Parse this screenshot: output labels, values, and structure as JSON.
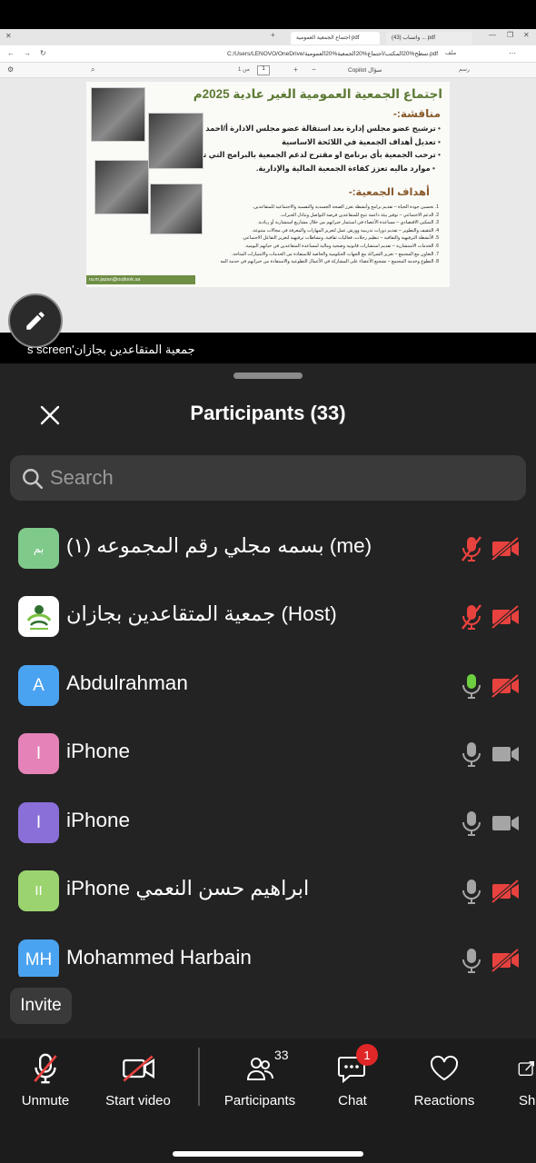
{
  "shared_screen": {
    "caption": "s screen'جمعية المتقاعدين بجازان",
    "browser": {
      "tabs": [
        "اجتماع الجمعية العمومية pdf",
        "(43) واتساب ... pdf"
      ],
      "url": "C:/Users/LENOVO/OneDrive/سطح%20المكتب/اجتماع%20الجمعية%20العمومية.pdf",
      "url_prefix": "ملف",
      "pdf_toolbar": {
        "copilot": "Copilot  سؤال",
        "page_current": "1",
        "page_total": "من 1",
        "draw_label": "رسم"
      }
    },
    "slide": {
      "title": "اجتماع الجمعية العمومية الغير عادية 2025م",
      "discussion_heading": "مناقشة:-",
      "bullets": [
        "ترشيح عضو مجلس إدارة بعد استقالة عضو مجلس الادارة أ/احمد كناني",
        "تعديل أهداف الجمعية في اللائحة الاساسية",
        "ترحب الجمعية بأي برنامج او مقترح لدعم الجمعية بالبرامج التي تقدم",
        "موارد ماليه تعزز كفاءة الجمعية المالية والإدارية."
      ],
      "goals_heading": "أهداف الجمعية:-",
      "goals": [
        "1. تحسين جودة الحياة – تقديم برامج وأنشطة تعزز الصحة الجسدية والنفسية والاجتماعية للمتقاعدين.",
        "2. الدعم الاجتماعي – توفير بيئة داعمة تتيح للمتقاعدين فرصة التواصل وتبادل الخبرات.",
        "3. التمكين الاقتصادي – مساعدة الأعضاء في استثمار خبراتهم من خلال مشاريع استشارية أو ريادية.",
        "4. التثقيف والتطوير – تقديم دورات تدريبية وورش عمل لتعزيز المهارات والمعرفة في مجالات متنوعة.",
        "5. الأنشطة الترفيهية والثقافية – تنظيم رحلات، فعاليات ثقافية، ونشاطات ترفيهية لتعزيز التفاعل الاجتماعي.",
        "6. الخدمات الاستشارية – تقديم استشارات قانونية وصحية ومالية لمساعدة المتقاعدين في حياتهم اليومية.",
        "7. التعاون مع المجتمع – تعزيز الشراكة مع الجهات الحكومية والخاصة للاستفادة من الخدمات والامتيازات المتاحة.",
        "8. التطوع وخدمة المجتمع – تشجيع الأعضاء على المشاركة في الأعمال التطوعية والاستفادة من خبراتهم في خدمة المجتمع."
      ],
      "email": "ra.m.jazan@outlook.sa"
    }
  },
  "panel": {
    "title": "Participants (33)",
    "search_placeholder": "Search",
    "participants": [
      {
        "name": "بسمه مجلي رقم المجموعه (١) (me)",
        "initials": "بم",
        "avatar_color": "#7fc98b",
        "mic": "muted",
        "video": "off"
      },
      {
        "name": "جمعية المتقاعدين بجازان (Host)",
        "initials": "",
        "avatar_color": "#ffffff",
        "avatar_type": "logo",
        "mic": "muted",
        "video": "off"
      },
      {
        "name": "Abdulrahman",
        "initials": "A",
        "avatar_color": "#4aa3f0",
        "mic": "speaking",
        "video": "off"
      },
      {
        "name": "iPhone",
        "initials": "I",
        "avatar_color": "#e583b9",
        "mic": "unmuted",
        "video": "on"
      },
      {
        "name": "iPhone",
        "initials": "I",
        "avatar_color": "#8a6fd9",
        "mic": "unmuted",
        "video": "on"
      },
      {
        "name": "iPhone ابراهيم حسن النعمي",
        "initials": "II",
        "avatar_color": "#9bd36f",
        "mic": "unmuted",
        "video": "off"
      },
      {
        "name": "Mohammed Harbain",
        "initials": "MH",
        "avatar_color": "#4aa3f0",
        "mic": "unmuted",
        "video": "off"
      }
    ]
  },
  "invite_label": "Invite",
  "toolbar": {
    "unmute": "Unmute",
    "start_video": "Start video",
    "participants": "Participants",
    "participants_count": "33",
    "chat": "Chat",
    "chat_badge": "1",
    "reactions": "Reactions",
    "share": "Share"
  },
  "colors": {
    "muted_red": "#e8423f",
    "speaking_green": "#6dcf3f",
    "icon_gray": "#a5a5a5",
    "panel_bg": "#232323"
  }
}
